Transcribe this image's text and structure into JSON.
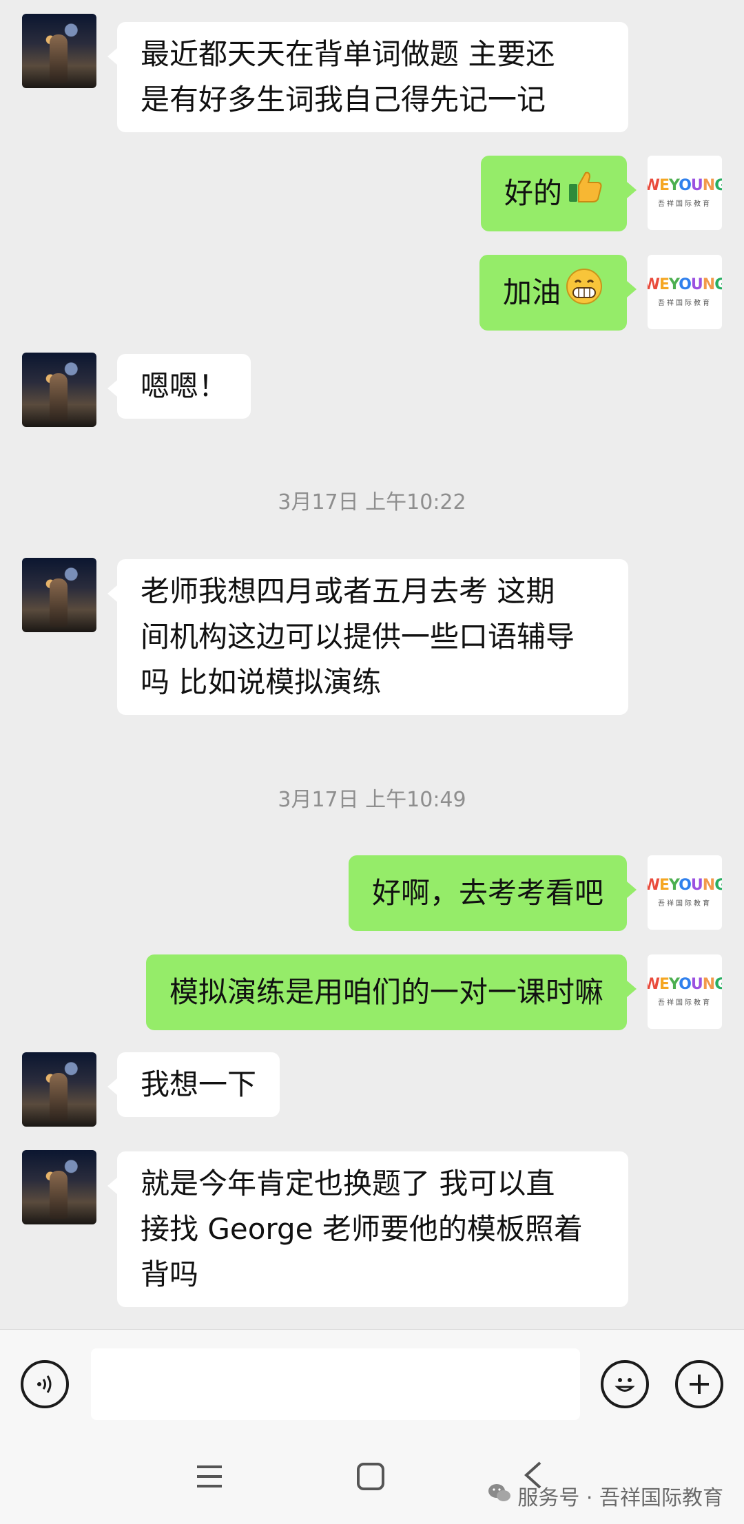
{
  "chat": {
    "messages": [
      {
        "side": "in",
        "text": "最近都天天在背单词做题 主要还是有好多生词我自己得先记一记"
      },
      {
        "side": "out",
        "text": "好的",
        "emoji": "thumbs-up-icon"
      },
      {
        "side": "out",
        "text": "加油",
        "emoji": "grin-emoji"
      },
      {
        "side": "in",
        "text": "嗯嗯！"
      },
      {
        "timestamp": "3月17日 上午10:22"
      },
      {
        "side": "in",
        "text": "老师我想四月或者五月去考 这期间机构这边可以提供一些口语辅导吗 比如说模拟演练"
      },
      {
        "timestamp": "3月17日 上午10:49"
      },
      {
        "side": "out",
        "text": "好啊，去考考看吧"
      },
      {
        "side": "out",
        "text": "模拟演练是用咱们的一对一课时嘛"
      },
      {
        "side": "in",
        "text": "我想一下"
      },
      {
        "side": "in",
        "text": "就是今年肯定也换题了 我可以直接找 George 老师要他的模板照着背吗"
      }
    ],
    "timestamps": [
      "3月17日 上午10:22",
      "3月17日 上午10:49"
    ],
    "bubble_lines": {
      "m0": [
        "最近都天天在背单词做题 主要还",
        "是有好多生词我自己得先记一记"
      ],
      "m1": [
        "好的"
      ],
      "m2": [
        "加油"
      ],
      "m3": [
        "嗯嗯！"
      ],
      "m4": [
        "老师我想四月或者五月去考 这期",
        "间机构这边可以提供一些口语辅导",
        "吗 比如说模拟演练"
      ],
      "m5": [
        "好啊，去考考看吧"
      ],
      "m6": [
        "模拟演练是用咱们的一对一课时嘛"
      ],
      "m7": [
        "我想一下"
      ],
      "m8": [
        "就是今年肯定也换题了 我可以直",
        "接找 George 老师要他的模板照着",
        "背吗"
      ]
    }
  },
  "brand": {
    "logo_letters": [
      "W",
      "E",
      "Y",
      "O",
      "U",
      "N",
      "G"
    ],
    "logo_colors": [
      "#e94b3c",
      "#f5a623",
      "#4caf50",
      "#2f80ed",
      "#9b51e0",
      "#f2994a",
      "#27ae60"
    ],
    "sub_text": "吾祥国际教育"
  },
  "input_bar": {
    "voice_icon": "voice-icon",
    "emoji_icon": "emoji-icon",
    "plus_icon": "plus-icon",
    "input_value": ""
  },
  "nav": {
    "menu_icon": "menu-icon",
    "home_icon": "home-square-icon",
    "back_icon": "back-chevron-icon"
  },
  "watermark": {
    "text": "服务号 · 吾祥国际教育",
    "icon": "wechat-icon"
  },
  "colors": {
    "background": "#ededed",
    "bubble_in": "#ffffff",
    "bubble_out": "#95ec69",
    "timestamp": "#8e8e8e"
  }
}
